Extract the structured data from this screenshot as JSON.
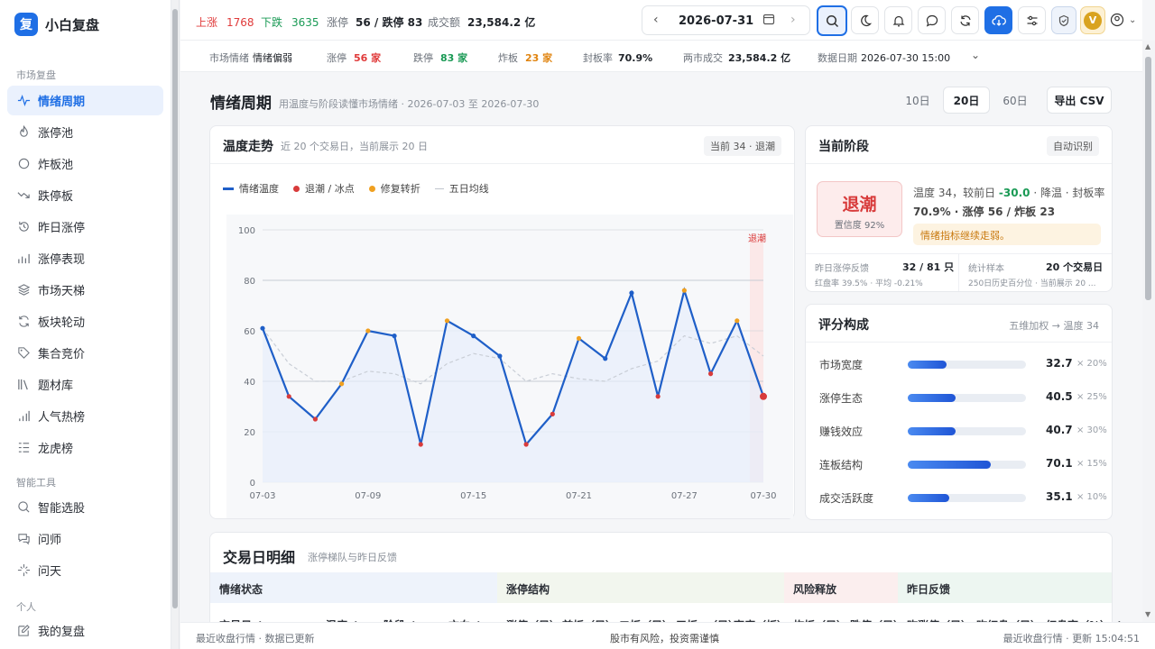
{
  "app": {
    "logo_char": "复",
    "name": "小白复盘"
  },
  "sidebar": {
    "section1": "市场复盘",
    "items": [
      {
        "label": "情绪周期",
        "icon": "pulse-icon"
      },
      {
        "label": "涨停池",
        "icon": "flame-icon"
      },
      {
        "label": "炸板池",
        "icon": "ring-icon"
      },
      {
        "label": "跌停板",
        "icon": "trend-down-icon"
      },
      {
        "label": "昨日涨停",
        "icon": "history-icon"
      },
      {
        "label": "涨停表现",
        "icon": "bar-chart-icon"
      },
      {
        "label": "市场天梯",
        "icon": "layers-icon"
      },
      {
        "label": "板块轮动",
        "icon": "refresh-icon"
      },
      {
        "label": "集合竞价",
        "icon": "tag-icon"
      },
      {
        "label": "题材库",
        "icon": "library-icon"
      },
      {
        "label": "人气热榜",
        "icon": "signal-icon"
      },
      {
        "label": "龙虎榜",
        "icon": "list-icon"
      }
    ],
    "section2": "智能工具",
    "tools": [
      {
        "label": "智能选股",
        "icon": "scan-icon"
      },
      {
        "label": "问师",
        "icon": "chat-icon"
      },
      {
        "label": "问天",
        "icon": "sparkle-icon"
      }
    ],
    "section3": "个人",
    "personal": [
      {
        "label": "我的复盘",
        "icon": "edit-icon"
      }
    ]
  },
  "topbar": {
    "up_label": "上涨",
    "up_value": "1768",
    "down_label": "下跌",
    "down_value": "3635",
    "limit_label": "涨停",
    "limit_value": "56 / 跌停 83",
    "turnover_label": "成交额",
    "turnover_value": "23,584.2 亿",
    "date": "2026-07-31",
    "avatar_letter": "V"
  },
  "subbar": {
    "mood_label": "市场情绪",
    "mood_value": "情绪偏弱",
    "limitup_label": "涨停",
    "limitup_value": "56 家",
    "limitdown_label": "跌停",
    "limitdown_value": "83 家",
    "broken_label": "炸板",
    "broken_value": "23 家",
    "seal_label": "封板率",
    "seal_value": "70.9%",
    "twomarket_label": "两市成交",
    "twomarket_value": "23,584.2 亿",
    "datadate_label": "数据日期",
    "datadate_value": "2026-07-30 15:00"
  },
  "page": {
    "title": "情绪周期",
    "subtitle": "用温度与阶段读懂市场情绪 · 2026-07-03 至 2026-07-30",
    "ranges": [
      "10日",
      "20日",
      "60日"
    ],
    "export": "导出 CSV"
  },
  "chart_card": {
    "title": "温度走势",
    "subtitle": "近 20 个交易日，当前展示 20 日",
    "badge": "当前 34 · 退潮",
    "legend": [
      "情绪温度",
      "退潮 / 冰点",
      "修复转折",
      "五日均线"
    ],
    "current_label": "退潮"
  },
  "chart_data": {
    "type": "line",
    "x": [
      "07-03",
      "07-06",
      "07-07",
      "07-08",
      "07-09",
      "07-10",
      "07-13",
      "07-14",
      "07-15",
      "07-16",
      "07-17",
      "07-20",
      "07-21",
      "07-22",
      "07-23",
      "07-24",
      "07-27",
      "07-28",
      "07-29",
      "07-30"
    ],
    "x_ticks": [
      "07-03",
      "07-09",
      "07-15",
      "07-21",
      "07-27",
      "07-30"
    ],
    "ylim": [
      0,
      100
    ],
    "y_ticks": [
      0,
      20,
      40,
      60,
      80,
      100
    ],
    "series": [
      {
        "name": "情绪温度",
        "values": [
          61,
          34,
          25,
          39,
          60,
          58,
          15,
          64,
          58,
          50,
          15,
          27,
          57,
          49,
          75,
          34,
          76,
          43,
          64,
          34
        ],
        "point_types": [
          "blue",
          "red",
          "red",
          "orange",
          "orange",
          "blue",
          "red",
          "orange",
          "blue",
          "blue",
          "red",
          "red",
          "orange",
          "blue",
          "blue",
          "red",
          "orange",
          "red",
          "orange",
          "red"
        ]
      },
      {
        "name": "五日均线",
        "values": [
          61,
          47,
          40,
          40,
          44,
          43,
          39,
          47,
          51,
          49,
          40,
          43,
          41,
          40,
          45,
          48,
          58,
          55,
          58,
          50
        ]
      }
    ],
    "colors": {
      "line": "#1f5fc8",
      "red": "#d83b3b",
      "orange": "#f0a020",
      "ma": "#c9ced6"
    }
  },
  "phase_card": {
    "title": "当前阶段",
    "auto": "自动识别",
    "phase": "退潮",
    "confidence": "置信度 92%",
    "desc_temp": "温度 34，较前日 ",
    "delta": "-30.0",
    "desc_rest": " · 降温 · 封板率",
    "desc_line2": "70.9% · 涨停 56 / 炸板 23",
    "warning": "情绪指标继续走弱。",
    "feedback_label": "昨日涨停反馈",
    "feedback_value": "32 / 81 只",
    "feedback_sub": "红盘率 39.5% · 平均 -0.21%",
    "sample_label": "统计样本",
    "sample_value": "20 个交易日",
    "sample_sub": "250日历史百分位 · 当前展示 20 ..."
  },
  "score_card": {
    "title": "评分构成",
    "subtitle": "五维加权 → 温度 34",
    "items": [
      {
        "label": "市场宽度",
        "value": "32.7",
        "weight": "× 20%",
        "pct": 0.327
      },
      {
        "label": "涨停生态",
        "value": "40.5",
        "weight": "× 25%",
        "pct": 0.405
      },
      {
        "label": "赚钱效应",
        "value": "40.7",
        "weight": "× 30%",
        "pct": 0.407
      },
      {
        "label": "连板结构",
        "value": "70.1",
        "weight": "× 15%",
        "pct": 0.701
      },
      {
        "label": "成交活跃度",
        "value": "35.1",
        "weight": "× 10%",
        "pct": 0.351
      }
    ]
  },
  "table_card": {
    "title": "交易日明细",
    "subtitle": "涨停梯队与昨日反馈",
    "groups": [
      "情绪状态",
      "涨停结构",
      "风险释放",
      "昨日反馈"
    ],
    "columns": [
      "交易日 ↕",
      "温度 ↕",
      "阶段 ↕",
      "方向 ↕",
      "涨停（只）",
      "首板（只）",
      "二板（只）",
      "三板+（只）",
      "高度（板）",
      "炸板（只）",
      "跌停（只）",
      "昨涨停（只）",
      "昨红盘（只）",
      "红盘率（%） ↕"
    ]
  },
  "footer": {
    "left": "最近收盘行情 · 数据已更新",
    "center": "股市有风险，投资需谨慎",
    "right": "最近收盘行情 · 更新 15:04:51"
  }
}
